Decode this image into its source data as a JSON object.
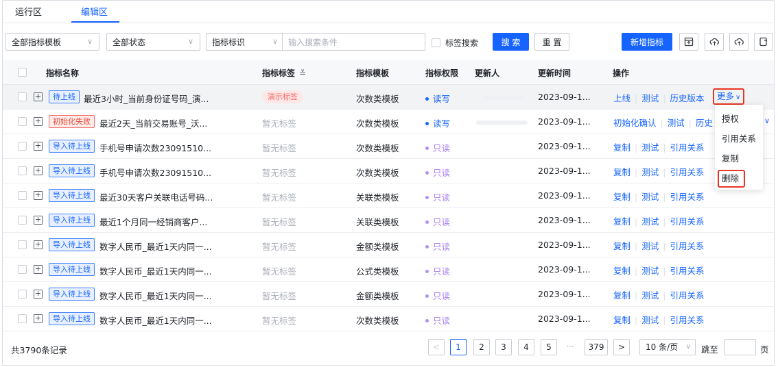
{
  "tabs": [
    {
      "label": "运行区",
      "active": false
    },
    {
      "label": "编辑区",
      "active": true
    }
  ],
  "toolbar": {
    "template_select": "全部指标模板",
    "status_select": "全部状态",
    "field_select": "指标标识",
    "search_placeholder": "输入搜索条件",
    "tag_search_label": "标签搜索",
    "search_button": "搜 索",
    "reset_button": "重 置",
    "add_button": "新增指标"
  },
  "table": {
    "headers": {
      "name": "指标名称",
      "tag": "指标标签",
      "template": "指标模板",
      "permission": "指标权限",
      "updater": "更新人",
      "updated_at": "更新时间",
      "actions": "操作"
    },
    "rows": [
      {
        "status": "待上线",
        "name": "最近3小时_当前身份证号码_演...",
        "tag": "演示标签",
        "template": "次数类模板",
        "permission": "读写",
        "time": "2023-09-1...",
        "ops": [
          "上线",
          "测试",
          "历史版本"
        ],
        "more": "更多"
      },
      {
        "status": "初始化失败",
        "name": "最近2天_当前交易账号_沃...",
        "tag": "暂无标签",
        "template": "次数类模板",
        "permission": "读写",
        "time": "2023-09-1...",
        "ops": [
          "初始化确认",
          "测试",
          "历史"
        ]
      },
      {
        "status": "导入待上线",
        "name": "手机号申请次数23091510...",
        "tag": "暂无标签",
        "template": "次数类模板",
        "permission": "只读",
        "time": "2023-09-1...",
        "ops": [
          "复制",
          "测试",
          "引用关系"
        ]
      },
      {
        "status": "导入待上线",
        "name": "手机号申请次数23091510...",
        "tag": "暂无标签",
        "template": "次数类模板",
        "permission": "只读",
        "time": "2023-09-1...",
        "ops": [
          "复制",
          "测试",
          "引用关系"
        ]
      },
      {
        "status": "导入待上线",
        "name": "最近30天客户关联电话号码...",
        "tag": "暂无标签",
        "template": "关联类模板",
        "permission": "只读",
        "time": "2023-09-1...",
        "ops": [
          "复制",
          "测试",
          "引用关系"
        ]
      },
      {
        "status": "导入待上线",
        "name": "最近1个月同一经销商客户...",
        "tag": "暂无标签",
        "template": "关联类模板",
        "permission": "只读",
        "time": "2023-09-1...",
        "ops": [
          "复制",
          "测试",
          "引用关系"
        ]
      },
      {
        "status": "导入待上线",
        "name": "数字人民币_最近1天内同一...",
        "tag": "暂无标签",
        "template": "金额类模板",
        "permission": "只读",
        "time": "2023-09-1...",
        "ops": [
          "复制",
          "测试",
          "引用关系"
        ]
      },
      {
        "status": "导入待上线",
        "name": "数字人民币_最近1天内同一...",
        "tag": "暂无标签",
        "template": "公式类模板",
        "permission": "只读",
        "time": "2023-09-1...",
        "ops": [
          "复制",
          "测试",
          "引用关系"
        ]
      },
      {
        "status": "导入待上线",
        "name": "数字人民币_最近1天内同一...",
        "tag": "暂无标签",
        "template": "金额类模板",
        "permission": "只读",
        "time": "2023-09-1...",
        "ops": [
          "复制",
          "测试",
          "引用关系"
        ]
      },
      {
        "status": "导入待上线",
        "name": "数字人民币_最近1天内同一...",
        "tag": "暂无标签",
        "template": "次数类模板",
        "permission": "只读",
        "time": "2023-09-1...",
        "ops": [
          "复制",
          "测试",
          "引用关系"
        ]
      }
    ]
  },
  "dropdown": {
    "items": [
      "授权",
      "引用关系",
      "复制",
      "删除"
    ]
  },
  "pagination": {
    "total": "共3790条记录",
    "pages": [
      "1",
      "2",
      "3",
      "4",
      "5",
      "···",
      "379"
    ],
    "current": "1",
    "page_size": "10 条/页",
    "jump_label": "跳至",
    "page_suffix": "页"
  },
  "colors": {
    "primary": "#1664ff",
    "danger_outline": "#ea3323",
    "readonly": "#a87ef2"
  }
}
